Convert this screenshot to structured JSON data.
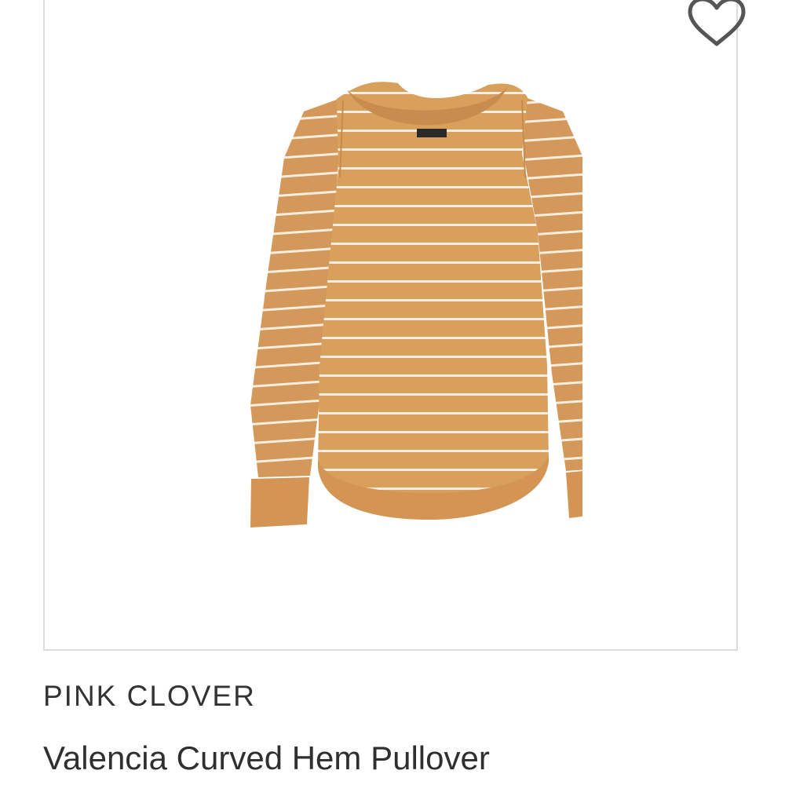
{
  "product": {
    "brand": "PINK CLOVER",
    "name": "Valencia Curved Hem Pullover",
    "image": {
      "icon": "striped-pullover-sweater-image",
      "body_color": "#d9a05c",
      "stripe_color": "#f6eee0"
    },
    "favorite": {
      "icon": "heart-outline-icon",
      "color": "#555555"
    }
  }
}
